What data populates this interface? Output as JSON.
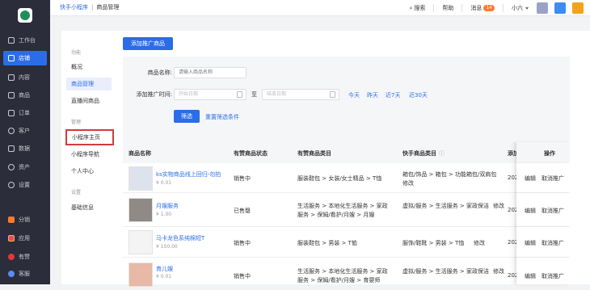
{
  "sidebar": {
    "items": [
      {
        "label": "工作台",
        "icon": "monitor-icon"
      },
      {
        "label": "店铺",
        "icon": "store-icon"
      },
      {
        "label": "内容",
        "icon": "content-icon"
      },
      {
        "label": "商品",
        "icon": "goods-icon"
      },
      {
        "label": "订单",
        "icon": "order-icon"
      },
      {
        "label": "客户",
        "icon": "customer-icon"
      },
      {
        "label": "数据",
        "icon": "chart-icon"
      },
      {
        "label": "资产",
        "icon": "asset-icon"
      },
      {
        "label": "设置",
        "icon": "gear-icon"
      },
      {
        "label": "分销",
        "icon": "distribution-icon"
      },
      {
        "label": "应用",
        "icon": "apps-icon"
      },
      {
        "label": "有赞",
        "icon": "youzan-icon"
      },
      {
        "label": "客服",
        "icon": "service-icon"
      }
    ],
    "active_index": 1,
    "accent": "#2b6de8"
  },
  "topbar": {
    "breadcrumb": [
      "快手小程序",
      "商品管理"
    ],
    "search": "搜索",
    "help": "帮助",
    "messages": "消息",
    "message_count": "14",
    "user": "小六"
  },
  "subnav": {
    "group1": "功能",
    "items1": [
      "概况",
      "商品管理",
      "直播间商品"
    ],
    "group2": "管理",
    "items2": [
      "小程序主页",
      "小程序导航",
      "个人中心"
    ],
    "group3": "设置",
    "items3": [
      "基础信息"
    ]
  },
  "main": {
    "add_button": "添加推广商品",
    "filter": {
      "name_label": "商品名称:",
      "name_placeholder": "请输入商品名称",
      "time_label": "添加推广时间:",
      "start_placeholder": "开始日期",
      "to": "至",
      "end_placeholder": "结束日期",
      "quick": [
        "今天",
        "昨天",
        "近7天",
        "近30天"
      ],
      "submit": "筛选",
      "reset": "重置筛选条件"
    },
    "table": {
      "headers": [
        "商品名称",
        "有赞商品状态",
        "有赞商品类目",
        "快手商品类目",
        "添加",
        "操作"
      ],
      "rows": [
        {
          "name": "ks实物商品线上回归-勿拍",
          "price": "¥ 0.01",
          "status": "销售中",
          "yz_cat": "服装鞋包 > 女装/女士精品 > T恤",
          "ks_cat_1": "箱包/饰品 > 箱包 > 功能箱包/双肩包",
          "ks_cat_2": "修改",
          "added": "202",
          "edit": "编辑",
          "cancel": "取消推广"
        },
        {
          "name": "月嫂服务",
          "price": "¥ 1.00",
          "status": "已售罄",
          "yz_cat": "生活服务 > 本地化生活服务 > 家政服务 > 保姆/看护/月嫂 > 月嫂",
          "ks_cat_1": "虚拟/服务 > 生活服务 > 家政保洁",
          "ks_cat_2": "修改",
          "added": "202",
          "edit": "编辑",
          "cancel": "取消推广"
        },
        {
          "name": "马卡龙色系纯棉短T",
          "price": "¥ 150.00",
          "status": "销售中",
          "yz_cat": "服装鞋包 > 男装 > T恤",
          "ks_cat_1": "服饰/鞋靴 > 男装 > T恤",
          "ks_cat_2": "修改",
          "added": "202",
          "edit": "编辑",
          "cancel": "取消推广"
        },
        {
          "name": "育儿嫂",
          "price": "¥ 0.01",
          "status": "销售中",
          "yz_cat": "生活服务 > 本地化生活服务 > 家政服务 > 保姆/看护/月嫂 > 育婴师",
          "ks_cat_1": "虚拟/服务 > 生活服务 > 家政保洁",
          "ks_cat_2": "修改",
          "added": "202",
          "edit": "编辑",
          "cancel": "取消推广"
        }
      ]
    }
  }
}
